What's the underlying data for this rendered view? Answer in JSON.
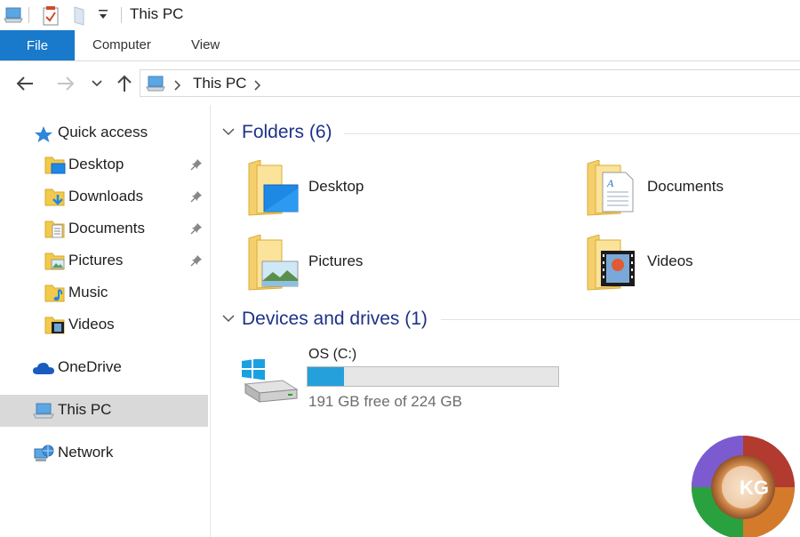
{
  "window": {
    "title": "This PC"
  },
  "ribbon": {
    "file_label": "File",
    "tabs": [
      "Computer",
      "View"
    ],
    "accent": "#1979ca"
  },
  "address": {
    "path": "This PC"
  },
  "sidebar": {
    "quick_access": "Quick access",
    "items": [
      {
        "label": "Desktop",
        "icon": "desktop-folder-icon",
        "pinned": true
      },
      {
        "label": "Downloads",
        "icon": "downloads-folder-icon",
        "pinned": true
      },
      {
        "label": "Documents",
        "icon": "documents-folder-icon",
        "pinned": true
      },
      {
        "label": "Pictures",
        "icon": "pictures-folder-icon",
        "pinned": true
      },
      {
        "label": "Music",
        "icon": "music-folder-icon",
        "pinned": false
      },
      {
        "label": "Videos",
        "icon": "videos-folder-icon",
        "pinned": false
      }
    ],
    "onedrive": "OneDrive",
    "this_pc": "This PC",
    "network": "Network"
  },
  "content": {
    "folders_heading": "Folders (6)",
    "folders": [
      {
        "name": "Desktop",
        "icon": "desktop-folder-icon"
      },
      {
        "name": "Documents",
        "icon": "documents-folder-icon"
      },
      {
        "name": "Pictures",
        "icon": "pictures-folder-icon"
      },
      {
        "name": "Videos",
        "icon": "videos-folder-icon"
      }
    ],
    "devices_heading": "Devices and drives (1)",
    "drive": {
      "name": "OS (C:)",
      "free_text": "191 GB free of 224 GB",
      "used_fraction": 0.147
    },
    "heading_color": "#1e3287"
  }
}
